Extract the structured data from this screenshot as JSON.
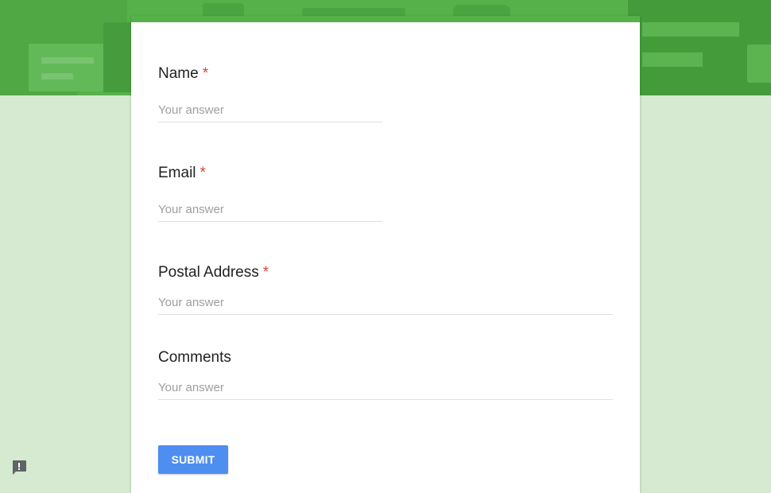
{
  "form": {
    "questions": [
      {
        "label": "Name",
        "required_mark": "*",
        "placeholder": "Your answer",
        "value": ""
      },
      {
        "label": "Email",
        "required_mark": "*",
        "placeholder": "Your answer",
        "value": ""
      },
      {
        "label": "Postal Address",
        "required_mark": "*",
        "placeholder": "Your answer",
        "value": ""
      },
      {
        "label": "Comments",
        "required_mark": "",
        "placeholder": "Your answer",
        "value": ""
      }
    ],
    "submit_label": "SUBMIT"
  },
  "colors": {
    "accent": "#57b14b",
    "background": "#d5ead0",
    "required": "#db4437",
    "submit": "#4d8ef0"
  },
  "icons": {
    "report": "report-problem-icon"
  }
}
